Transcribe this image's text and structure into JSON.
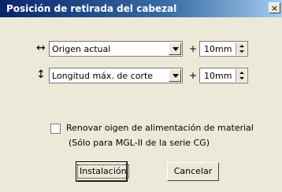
{
  "window": {
    "title": "Posición de retirada del cabezal",
    "close": "×"
  },
  "row1": {
    "icon": "horizontal-arrow-icon",
    "glyph": "↔",
    "select_value": "Origen actual",
    "plus": "+",
    "spin_value": "10mm"
  },
  "row2": {
    "icon": "vertical-arrow-icon",
    "glyph": "↕",
    "select_value": "Longitud máx. de corte",
    "plus": "+",
    "spin_value": "10mm"
  },
  "checkbox": {
    "label": "Renovar oigen de alimentación de material",
    "checked": false
  },
  "note": "(Sólo para MGL-II de la serie CG)",
  "buttons": {
    "install": "Instalación",
    "cancel": "Cancelar"
  }
}
